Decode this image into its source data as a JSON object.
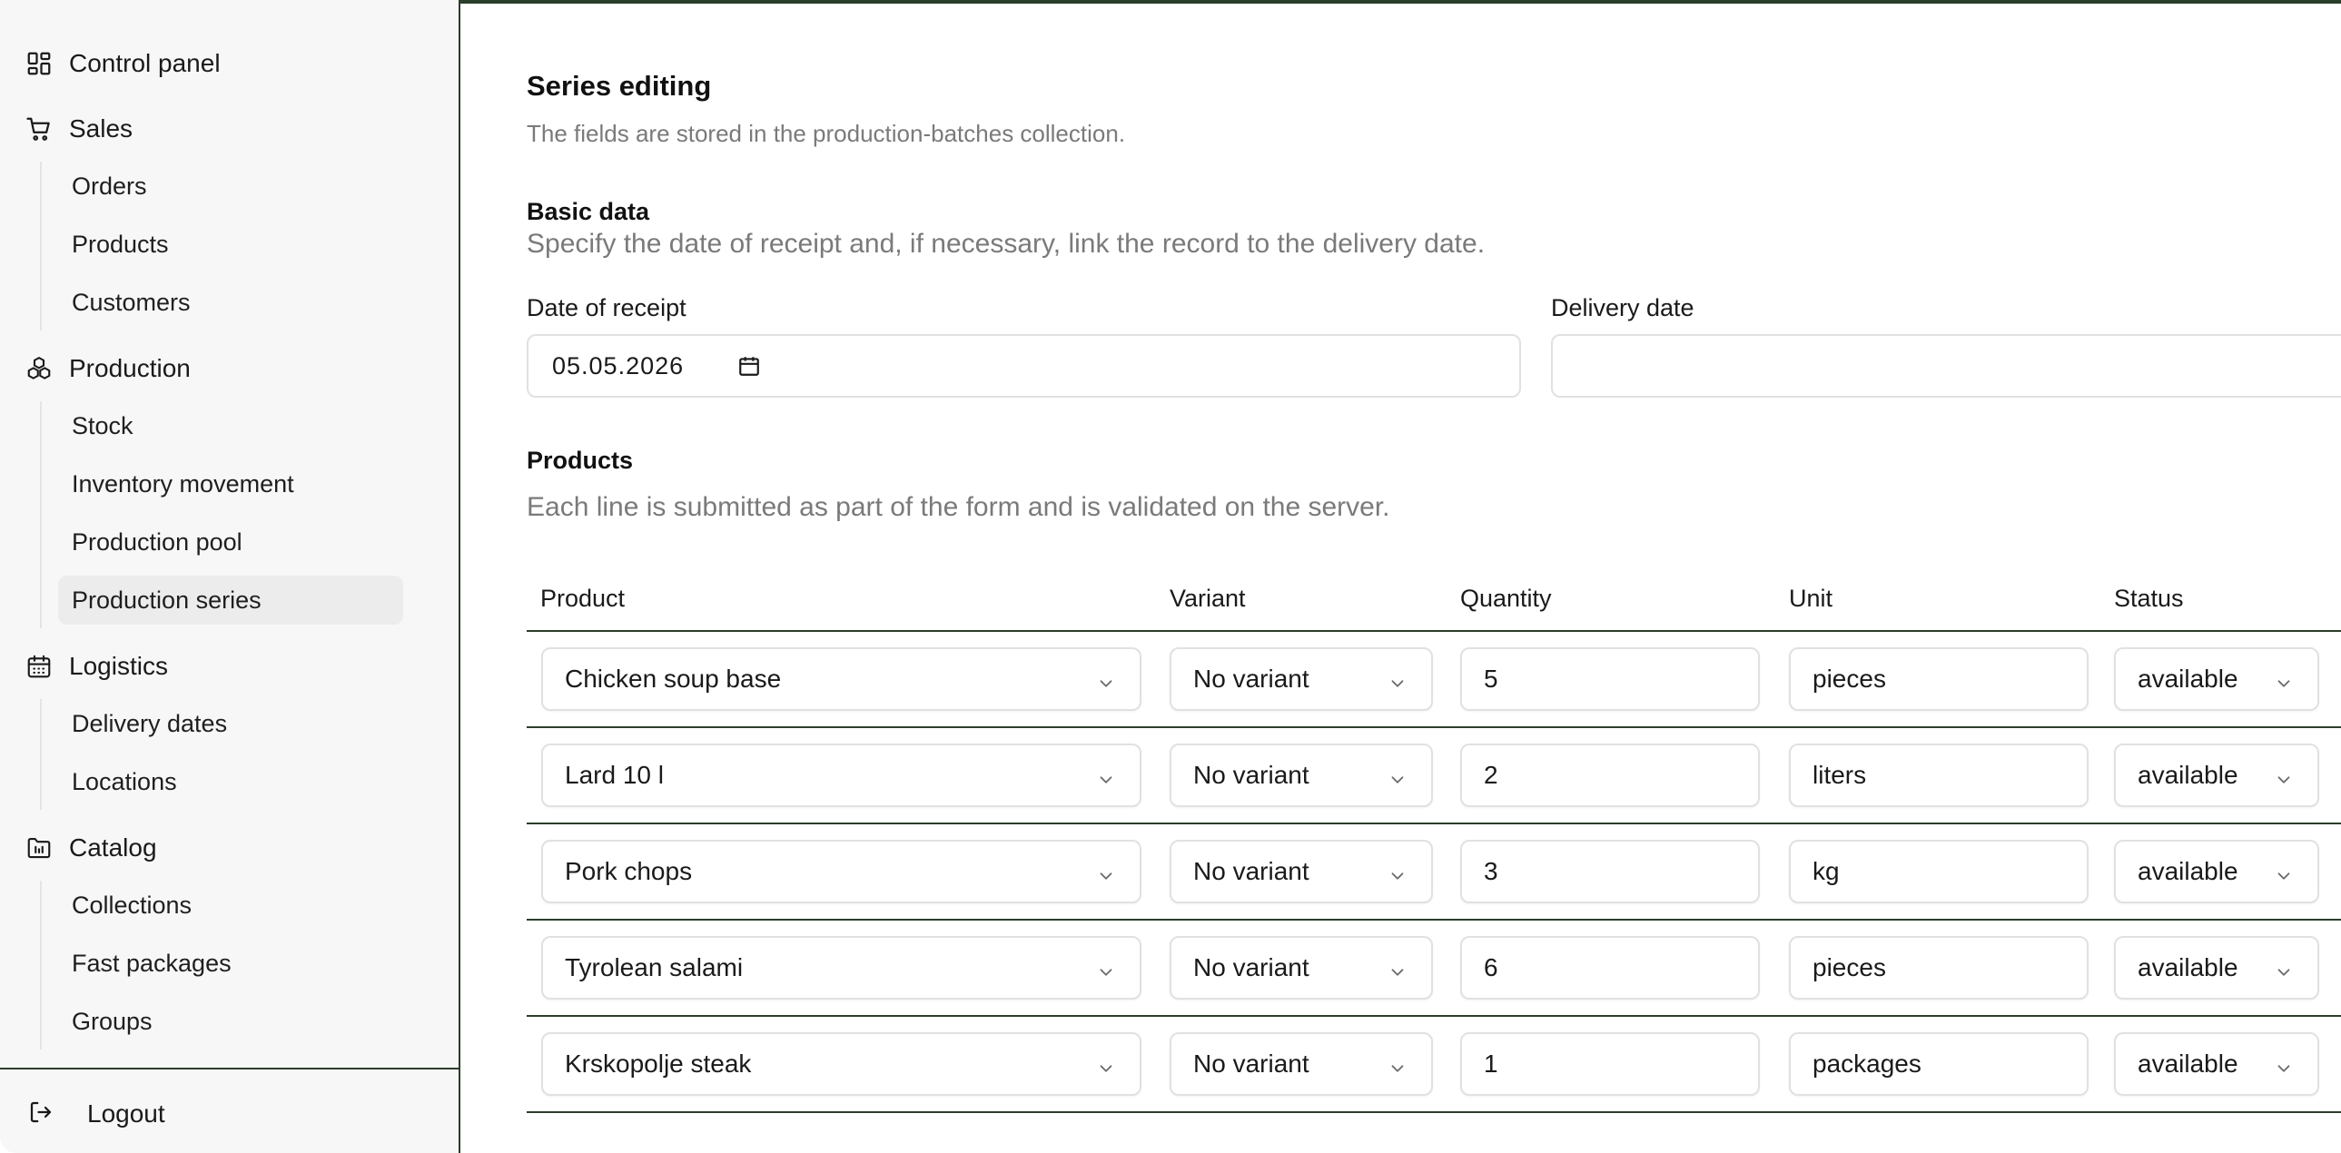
{
  "sidebar": {
    "sections": [
      {
        "label": "Control panel",
        "icon": "dashboard-icon"
      },
      {
        "label": "Sales",
        "icon": "cart-icon",
        "items": [
          "Orders",
          "Products",
          "Customers"
        ]
      },
      {
        "label": "Production",
        "icon": "boxes-icon",
        "items": [
          "Stock",
          "Inventory movement",
          "Production pool",
          "Production series"
        ]
      },
      {
        "label": "Logistics",
        "icon": "calendar-icon",
        "items": [
          "Delivery dates",
          "Locations"
        ]
      },
      {
        "label": "Catalog",
        "icon": "folder-icon",
        "items": [
          "Collections",
          "Fast packages",
          "Groups"
        ]
      }
    ],
    "active_item": "Production series",
    "logout_label": "Logout"
  },
  "page": {
    "title": "Series editing",
    "subtitle": "The fields are stored in the production-batches collection."
  },
  "basic": {
    "title": "Basic data",
    "desc": "Specify the date of receipt and, if necessary, link the record to the delivery date.",
    "receipt_label": "Date of receipt",
    "receipt_value": "05.05.2026",
    "delivery_label": "Delivery date",
    "delivery_value": ""
  },
  "products": {
    "title": "Products",
    "desc": "Each line is submitted as part of the form and is validated on the server.",
    "headers": {
      "product": "Product",
      "variant": "Variant",
      "quantity": "Quantity",
      "unit": "Unit",
      "status": "Status"
    },
    "rows": [
      {
        "product": "Chicken soup base",
        "variant": "No variant",
        "quantity": "5",
        "unit": "pieces",
        "status": "available"
      },
      {
        "product": "Lard 10 l",
        "variant": "No variant",
        "quantity": "2",
        "unit": "liters",
        "status": "available"
      },
      {
        "product": "Pork chops",
        "variant": "No variant",
        "quantity": "3",
        "unit": "kg",
        "status": "available"
      },
      {
        "product": "Tyrolean salami",
        "variant": "No variant",
        "quantity": "6",
        "unit": "pieces",
        "status": "available"
      },
      {
        "product": "Krskopolje steak",
        "variant": "No variant",
        "quantity": "1",
        "unit": "packages",
        "status": "available"
      }
    ]
  },
  "colors": {
    "accent_line": "#2b3d2b",
    "muted_text": "#7a7a7a",
    "active_bg": "#ececec"
  }
}
